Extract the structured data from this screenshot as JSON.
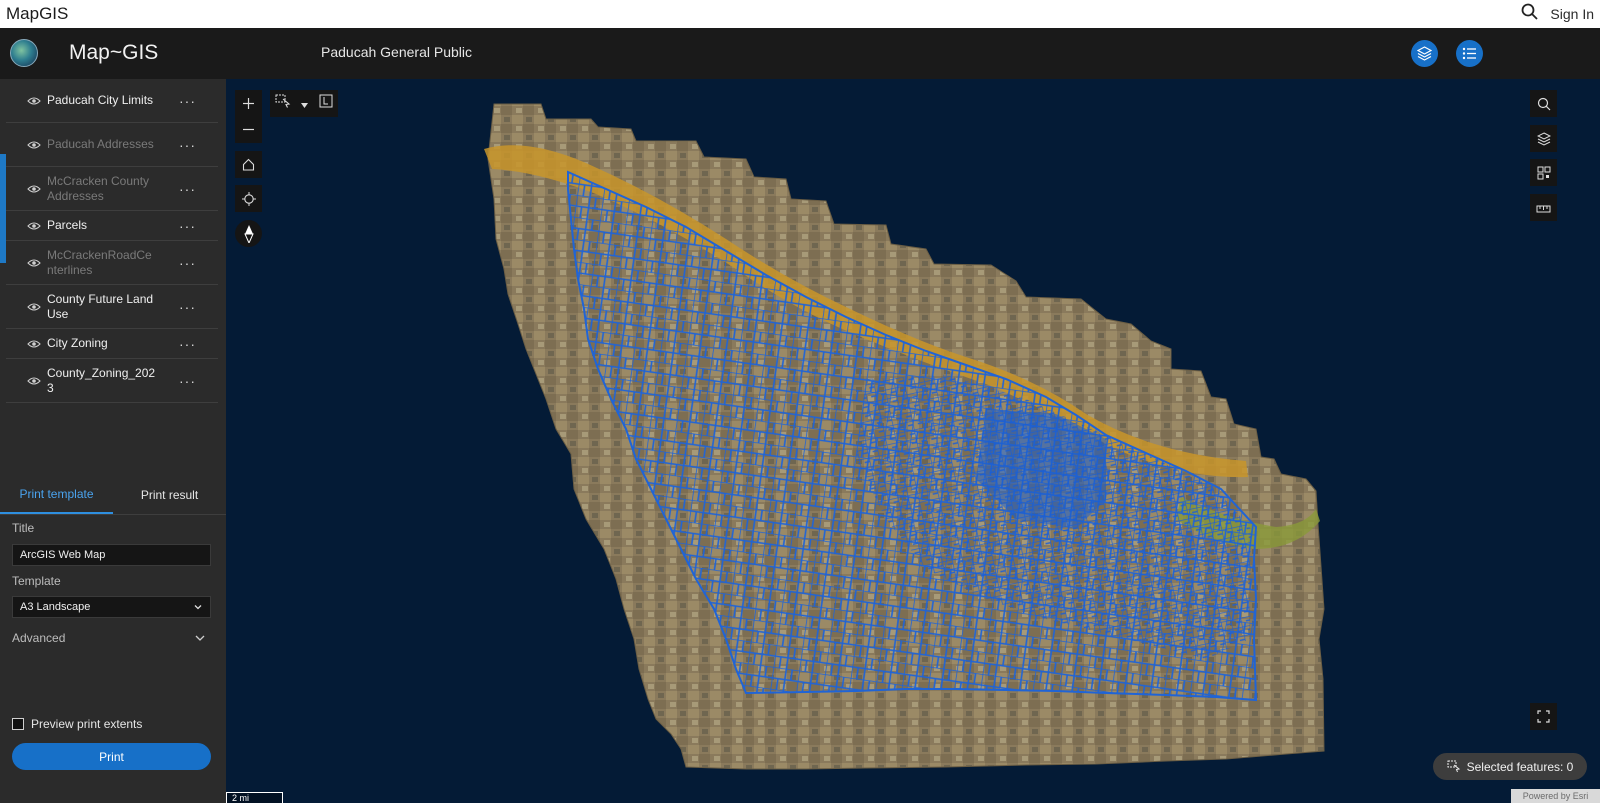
{
  "topbar": {
    "brand": "MapGIS",
    "signin": "Sign In"
  },
  "header": {
    "app_title": "Map~GIS",
    "subtitle": "Paducah General Public"
  },
  "layers": [
    {
      "name": "Paducah City Limits",
      "visible": true
    },
    {
      "name": "Paducah Addresses",
      "visible": false
    },
    {
      "name": "McCracken County Addresses",
      "visible": false
    },
    {
      "name": "Parcels",
      "visible": true
    },
    {
      "name": "McCrackenRoadCenterlines",
      "visible": false
    },
    {
      "name": "County Future Land Use",
      "visible": true
    },
    {
      "name": "City Zoning",
      "visible": true
    },
    {
      "name": "County_Zoning_2023",
      "visible": true
    }
  ],
  "more_label": "···",
  "print": {
    "tabs": [
      "Print template",
      "Print result"
    ],
    "title_label": "Title",
    "title_value": "ArcGIS Web Map",
    "template_label": "Template",
    "template_value": "A3 Landscape",
    "advanced_label": "Advanced",
    "preview_label": "Preview print extents",
    "print_button": "Print"
  },
  "map": {
    "scale_label": "2 mi",
    "attribution": "Powered by Esri",
    "selected_features": "Selected features: 0"
  },
  "icons": {
    "search": "search-icon",
    "layers": "layers-icon",
    "legend": "legend-icon",
    "zoom_in": "plus-icon",
    "zoom_out": "minus-icon",
    "home": "home-icon",
    "locate": "locate-icon",
    "compass": "compass-icon",
    "fullscreen": "fullscreen-icon"
  },
  "colors": {
    "accent": "#1770c8",
    "panel": "#2b2b2b",
    "header": "#1a1a1a",
    "map_bg": "#041b36",
    "parcels": "#1f5fd0",
    "river": "#c8952a"
  }
}
